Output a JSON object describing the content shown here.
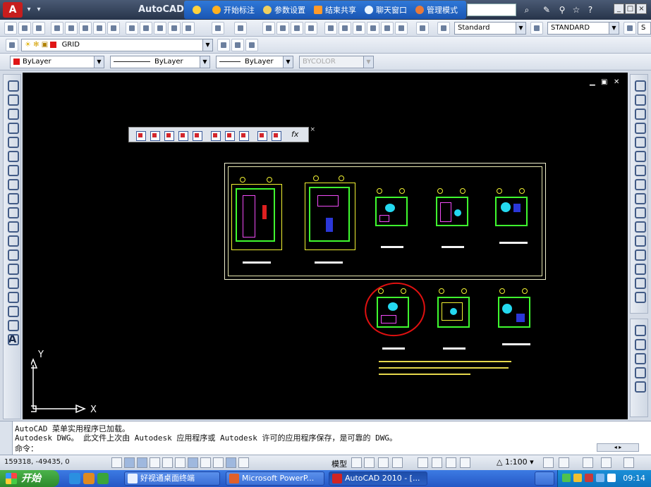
{
  "titlebar": {
    "app_title": "AutoCAD 2",
    "overlay_menu": [
      "开始标注",
      "参数设置",
      "结束共享",
      "聊天窗口",
      "管理模式"
    ],
    "logo_text": "A"
  },
  "toolbar_styles": {
    "text_style": "Standard",
    "dim_style": "STANDARD",
    "extra": "S"
  },
  "layer_toolbar": {
    "layer_name": "GRID"
  },
  "properties_toolbar": {
    "color": "ByLayer",
    "linetype": "ByLayer",
    "lineweight": "ByLayer",
    "plotstyle": "BYCOLOR"
  },
  "viewport_controls": [
    "▁",
    "▣",
    "✕"
  ],
  "float_toolbar": {
    "fx_label": "fx",
    "close": "×"
  },
  "ucs": {
    "x_label": "X",
    "y_label": "Y"
  },
  "command": {
    "lines": [
      "AutoCAD 菜单实用程序已加载。",
      "Autodesk DWG。  此文件上次由 Autodesk 应用程序或 Autodesk 许可的应用程序保存，是可靠的 DWG。",
      "命令："
    ]
  },
  "status": {
    "coordinates": "159318, -49435, 0",
    "model": "模型",
    "scale": "1:100"
  },
  "taskbar": {
    "start": "开始",
    "tasks": [
      {
        "label": "好视通桌面终端",
        "active": false
      },
      {
        "label": "Microsoft PowerP...",
        "active": false
      },
      {
        "label": "AutoCAD 2010 - [...",
        "active": true
      }
    ],
    "clock": "09:14"
  },
  "colors": {
    "canvas": "#000000",
    "taskbar": "#2457c5",
    "wall_green": "#3ffb2f",
    "annotation_red": "#e01010"
  }
}
